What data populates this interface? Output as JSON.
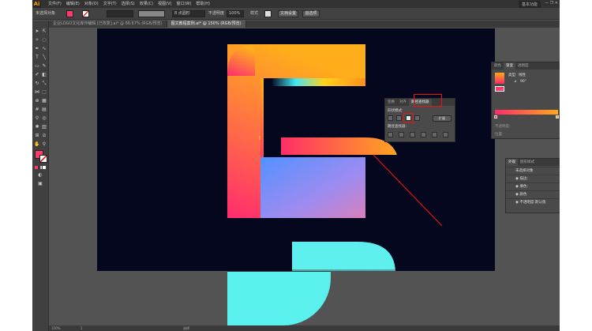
{
  "app": {
    "logo": "Ai",
    "menus": [
      "文件(F)",
      "编辑(E)",
      "对象(O)",
      "文字(T)",
      "选择(S)",
      "效果(C)",
      "视图(V)",
      "窗口(W)",
      "帮助(H)"
    ],
    "workspace": "基本功能",
    "window_controls": "—  ❐  ✕"
  },
  "control_bar": {
    "selection": "未选择对象",
    "stroke_style": "8 点圆形",
    "opacity_label": "不透明度",
    "opacity_value": "100%",
    "style_label": "样式",
    "doc_setup": "文档设置",
    "preferences": "首选项"
  },
  "tabs": [
    "企业LOGO文化库作编辑 [已恢复].ai* @ 66.67% (RGB/预览)",
    "图文教程案例.ai* @ 150% (RGB/预览)"
  ],
  "status": {
    "zoom": "150%",
    "page": "1",
    "mode": "选择"
  },
  "pathfinder": {
    "tabs": [
      "变换",
      "对齐",
      "路径查找器"
    ],
    "shape_modes_label": "形状模式:",
    "expand_label": "扩展",
    "pathfinders_label": "路径查找器:"
  },
  "gradient": {
    "tabs": [
      "颜色",
      "渐变",
      "透明度"
    ],
    "type_label": "类型:",
    "type_value": "线性",
    "angle_value": "90°",
    "opacity_label": "不透明度:",
    "location_label": "位置:"
  },
  "appearance": {
    "tabs": [
      "外观",
      "图形样式"
    ],
    "items": [
      "未选择对象",
      "描边:",
      "填色:",
      "颜色",
      "不透明度:"
    ],
    "opacity_value": "默认值"
  },
  "colors": {
    "gradient_start": "#ff2a6a",
    "gradient_end": "#ffaa1a",
    "cyan": "#5af0ee",
    "canvas": "#04061d",
    "highlight": "#e01010"
  }
}
